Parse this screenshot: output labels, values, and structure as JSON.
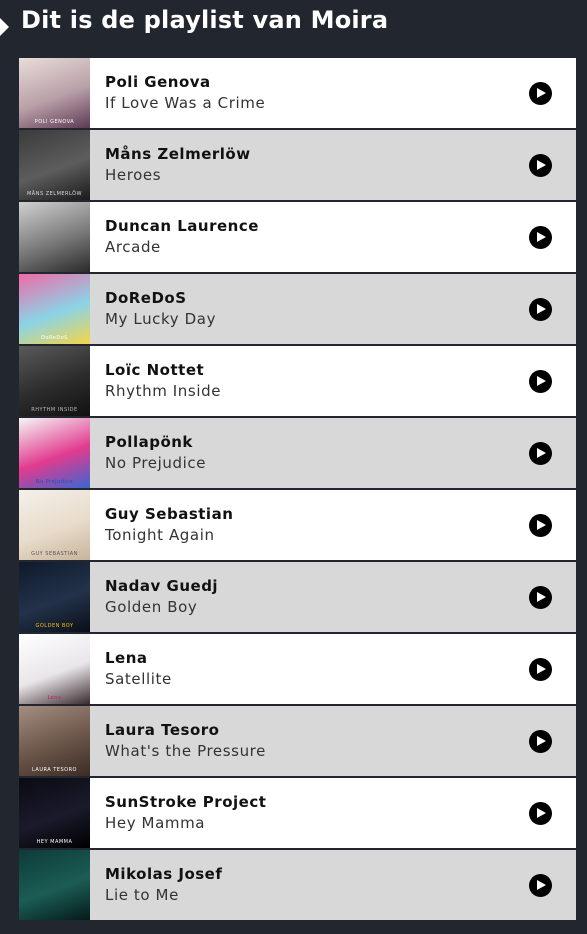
{
  "header": {
    "title": "Dit is de playlist van Moira"
  },
  "playlist": [
    {
      "artist": "Poli Genova",
      "song": "If Love Was a Crime",
      "cover_caption": "POLI GENOVA",
      "cover_colors": [
        "#e8ddd8",
        "#b9a0a8",
        "#5e3a55"
      ],
      "cover_caption_color": "#ffffff"
    },
    {
      "artist": "Måns Zelmerlöw",
      "song": "Heroes",
      "cover_caption": "MÅNS ZELMERLÖW",
      "cover_colors": [
        "#3b3b3b",
        "#5d5d5d",
        "#1a1a1a"
      ],
      "cover_caption_color": "#dddddd"
    },
    {
      "artist": "Duncan Laurence",
      "song": "Arcade",
      "cover_caption": "",
      "cover_colors": [
        "#d0d0d0",
        "#7a7a7a",
        "#2a2a2a"
      ],
      "cover_caption_color": "#ffffff"
    },
    {
      "artist": "DoReDoS",
      "song": "My Lucky Day",
      "cover_caption": "DoReDoS",
      "cover_colors": [
        "#f06aa8",
        "#8bd3e6",
        "#f5d547"
      ],
      "cover_caption_color": "#ffffff"
    },
    {
      "artist": "Loïc Nottet",
      "song": "Rhythm Inside",
      "cover_caption": "RHYTHM INSIDE",
      "cover_colors": [
        "#5a5a5a",
        "#2c2c2c",
        "#111111"
      ],
      "cover_caption_color": "#bbbbbb"
    },
    {
      "artist": "Pollapönk",
      "song": "No Prejudice",
      "cover_caption": "No Prejudice",
      "cover_colors": [
        "#f6f6f6",
        "#e23b8f",
        "#3a66d0"
      ],
      "cover_caption_color": "#1f4fb8"
    },
    {
      "artist": "Guy Sebastian",
      "song": "Tonight Again",
      "cover_caption": "GUY SEBASTIAN",
      "cover_colors": [
        "#f4f0ea",
        "#e8dccb",
        "#c8b49a"
      ],
      "cover_caption_color": "#555555"
    },
    {
      "artist": "Nadav Guedj",
      "song": "Golden Boy",
      "cover_caption": "GOLDEN BOY",
      "cover_colors": [
        "#0f1a2b",
        "#23324a",
        "#0a0f18"
      ],
      "cover_caption_color": "#f2c200"
    },
    {
      "artist": "Lena",
      "song": "Satellite",
      "cover_caption": "Lena",
      "cover_colors": [
        "#ffffff",
        "#e9e6ea",
        "#3a2a2e"
      ],
      "cover_caption_color": "#c0186b"
    },
    {
      "artist": "Laura Tesoro",
      "song": "What's the Pressure",
      "cover_caption": "LAURA TESORO",
      "cover_colors": [
        "#a48e80",
        "#6b5549",
        "#3a2c25"
      ],
      "cover_caption_color": "#ffffff"
    },
    {
      "artist": "SunStroke Project",
      "song": "Hey Mamma",
      "cover_caption": "HEY MAMMA",
      "cover_colors": [
        "#0b0b12",
        "#1a1a2c",
        "#000000"
      ],
      "cover_caption_color": "#ffffff"
    },
    {
      "artist": "Mikolas Josef",
      "song": "Lie to Me",
      "cover_caption": "",
      "cover_colors": [
        "#0d3b3a",
        "#1b5d55",
        "#051a19"
      ],
      "cover_caption_color": "#ffffff"
    }
  ],
  "icons": {
    "play": "play-icon",
    "header_marker": "chevron-right-icon"
  },
  "colors": {
    "page_background": "#22272f",
    "row_light": "#ffffff",
    "row_alt": "#d8d8d8",
    "play_button": "#000000"
  }
}
